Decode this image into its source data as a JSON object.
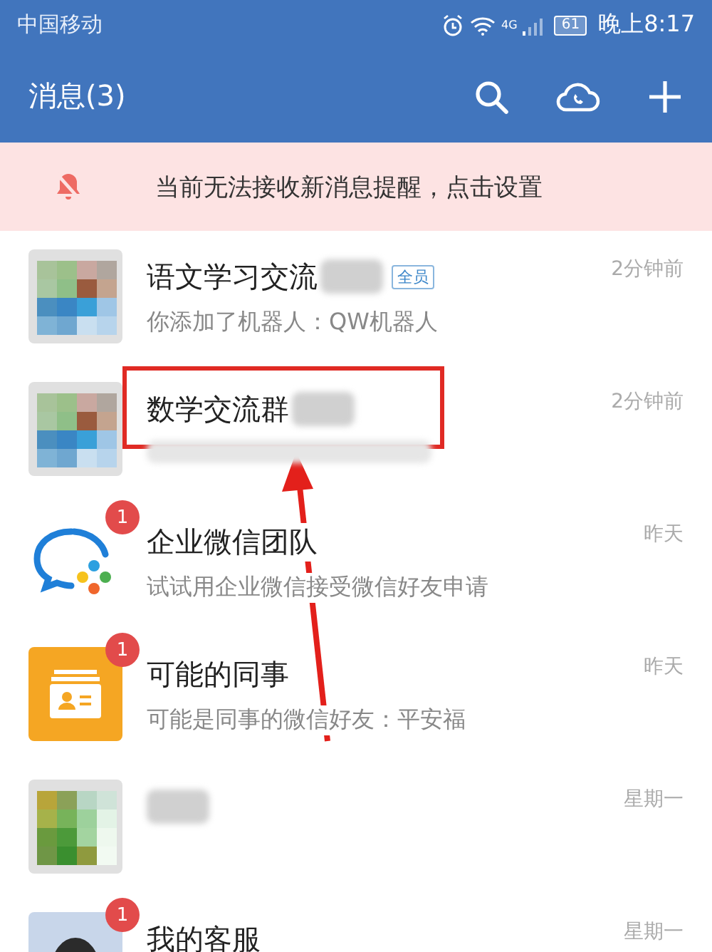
{
  "status_bar": {
    "carrier": "中国移动",
    "network": "4G",
    "battery": "61",
    "time": "晚上8:17"
  },
  "header": {
    "title": "消息(3)"
  },
  "banner": {
    "text": "当前无法接收新消息提醒，点击设置"
  },
  "conversations": [
    {
      "kind": "mosaic",
      "name": "语文学习交流",
      "name_redacted": true,
      "tag": "全员",
      "preview": "你添加了机器人：QW机器人",
      "preview_redacted": false,
      "time": "2分钟前",
      "highlighted": false
    },
    {
      "kind": "mosaic",
      "name": "数学交流群",
      "name_redacted": true,
      "preview_redacted": true,
      "time": "2分钟前",
      "highlighted": true
    },
    {
      "kind": "chat-logo",
      "badge": "1",
      "name": "企业微信团队",
      "name_redacted": false,
      "preview": "试试用企业微信接受微信好友申请",
      "preview_redacted": false,
      "time": "昨天",
      "highlighted": false
    },
    {
      "kind": "card",
      "badge": "1",
      "name": "可能的同事",
      "name_redacted": false,
      "preview": "可能是同事的微信好友：平安福",
      "preview_redacted": false,
      "time": "昨天",
      "highlighted": false
    },
    {
      "kind": "mosaic-green",
      "name_redacted": true,
      "preview_redacted": false,
      "time": "星期一",
      "highlighted": false
    },
    {
      "badge": "1",
      "name": "我的客服",
      "name_redacted": false,
      "preview_redacted": false,
      "time": "星期一",
      "highlighted": false
    }
  ]
}
